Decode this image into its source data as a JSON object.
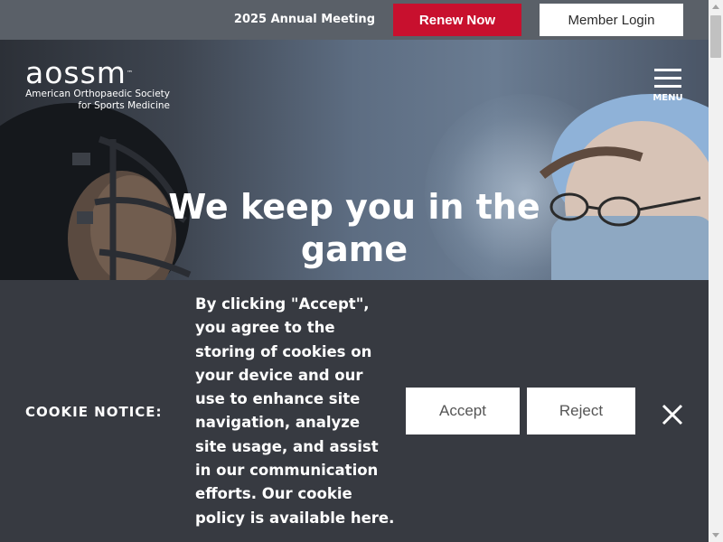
{
  "topbar": {
    "meeting_label": "2025 Annual Meeting",
    "renew_label": "Renew Now",
    "login_label": "Member Login"
  },
  "brand": {
    "wordmark": "aossm",
    "tm": "™",
    "subtitle_line1": "American Orthopaedic Society",
    "subtitle_line2": "for Sports Medicine"
  },
  "nav": {
    "menu_label": "MENU"
  },
  "hero": {
    "headline_line1": "We keep you in the",
    "headline_line2": "game"
  },
  "cookie": {
    "title": "COOKIE NOTICE:",
    "message": "By clicking \"Accept\", you agree to the storing of cookies on your device and our use to enhance site navigation, analyze site usage, and assist in our communication efforts. Our cookie policy is available here.",
    "accept_label": "Accept",
    "reject_label": "Reject"
  },
  "colors": {
    "accent_red": "#c8102e",
    "topbar_bg": "#5a6068",
    "banner_bg": "#373a41"
  },
  "icons": [
    "menu-icon",
    "close-icon",
    "scroll-up-icon",
    "scroll-down-icon"
  ]
}
